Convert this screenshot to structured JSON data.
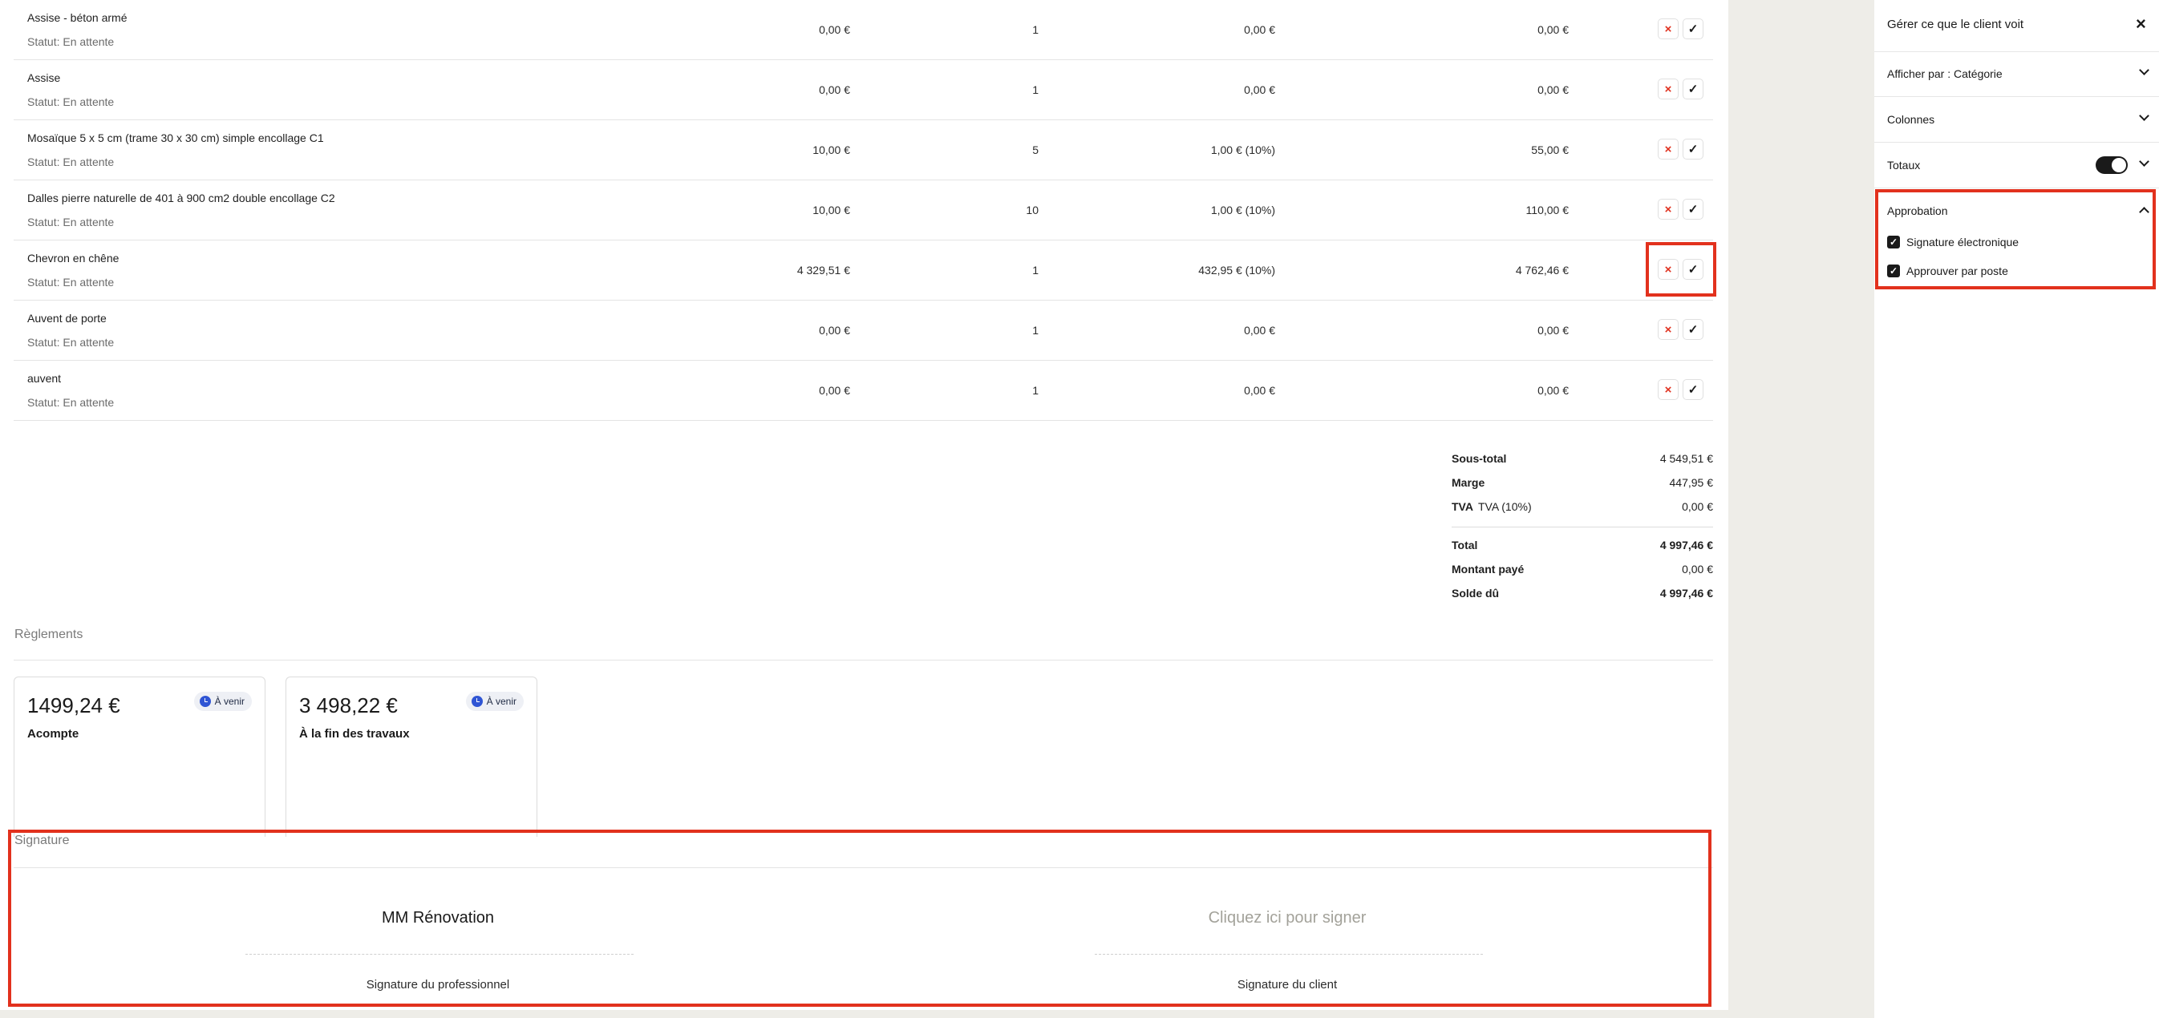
{
  "rows": [
    {
      "name": "Assise - béton armé",
      "status": "Statut: En attente",
      "unit_price": "0,00 €",
      "qty": "1",
      "tax": "0,00 €",
      "total": "0,00 €"
    },
    {
      "name": "Assise",
      "status": "Statut: En attente",
      "unit_price": "0,00 €",
      "qty": "1",
      "tax": "0,00 €",
      "total": "0,00 €"
    },
    {
      "name": "Mosaïque 5 x 5 cm (trame 30 x 30 cm) simple encollage C1",
      "status": "Statut: En attente",
      "unit_price": "10,00 €",
      "qty": "5",
      "tax": "1,00 € (10%)",
      "total": "55,00 €"
    },
    {
      "name": "Dalles pierre naturelle de 401 à 900 cm2 double encollage C2",
      "status": "Statut: En attente",
      "unit_price": "10,00 €",
      "qty": "10",
      "tax": "1,00 € (10%)",
      "total": "110,00 €"
    },
    {
      "name": "Chevron en chêne",
      "status": "Statut: En attente",
      "unit_price": "4 329,51 €",
      "qty": "1",
      "tax": "432,95 € (10%)",
      "total": "4 762,46 €"
    },
    {
      "name": "Auvent de porte",
      "status": "Statut: En attente",
      "unit_price": "0,00 €",
      "qty": "1",
      "tax": "0,00 €",
      "total": "0,00 €"
    },
    {
      "name": "auvent",
      "status": "Statut: En attente",
      "unit_price": "0,00 €",
      "qty": "1",
      "tax": "0,00 €",
      "total": "0,00 €"
    }
  ],
  "actions": {
    "reject_icon": "×",
    "approve_icon": "✓"
  },
  "totals": {
    "subtotal": {
      "label": "Sous-total",
      "value": "4 549,51 €"
    },
    "margin": {
      "label": "Marge",
      "value": "447,95 €"
    },
    "vat": {
      "label": "TVA",
      "sublabel": "TVA (10%)",
      "value": "0,00 €"
    },
    "total": {
      "label": "Total",
      "value": "4 997,46 €"
    },
    "paid": {
      "label": "Montant payé",
      "value": "0,00 €"
    },
    "balance": {
      "label": "Solde dû",
      "value": "4 997,46 €"
    }
  },
  "payments": {
    "title": "Règlements",
    "cards": [
      {
        "amount": "1499,24 €",
        "label": "Acompte",
        "badge": "À venir"
      },
      {
        "amount": "3 498,22 €",
        "label": "À la fin des travaux",
        "badge": "À venir"
      }
    ]
  },
  "signature": {
    "title": "Signature",
    "company": "MM Rénovation",
    "click_prompt": "Cliquez ici pour signer",
    "pro_caption": "Signature du professionnel",
    "client_caption": "Signature du client"
  },
  "panel": {
    "title": "Gérer ce que le client voit",
    "close_icon": "×",
    "display_by": "Afficher par : Catégorie",
    "columns": "Colonnes",
    "totals": "Totaux",
    "totals_toggle_on": true,
    "approval": "Approbation",
    "checkbox_mark": "✓",
    "approval_options": [
      {
        "label": "Signature électronique",
        "checked": true
      },
      {
        "label": "Approuver par poste",
        "checked": true
      }
    ]
  },
  "colors": {
    "highlight": "#e2311d",
    "reject": "#e0301e",
    "badge_icon": "#2f55d4",
    "gutter": "#eeede8"
  }
}
